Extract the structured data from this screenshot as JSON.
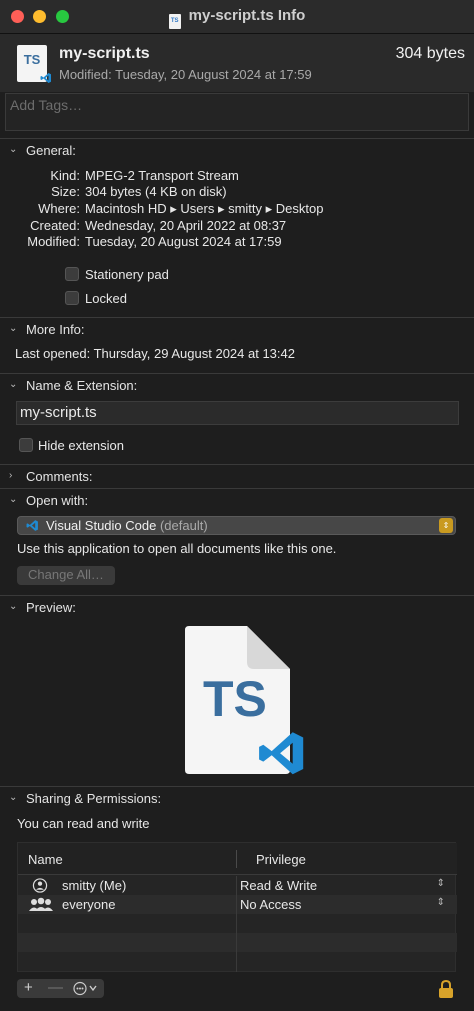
{
  "window": {
    "title": "my-script.ts Info"
  },
  "header": {
    "file_name": "my-script.ts",
    "modified_line": "Modified: Tuesday, 20 August 2024 at 17:59",
    "size": "304 bytes",
    "icon_text": "TS"
  },
  "tags": {
    "placeholder": "Add Tags…"
  },
  "general": {
    "title": "General:",
    "rows": [
      {
        "key": "Kind:",
        "value": "MPEG-2 Transport Stream"
      },
      {
        "key": "Size:",
        "value": "304 bytes (4 KB on disk)"
      },
      {
        "key": "Where:",
        "value": "Macintosh HD ▸ Users ▸ smitty ▸ Desktop"
      },
      {
        "key": "Created:",
        "value": "Wednesday, 20 April 2022 at 08:37"
      },
      {
        "key": "Modified:",
        "value": "Tuesday, 20 August 2024 at 17:59"
      }
    ],
    "stationery_label": "Stationery pad",
    "stationery_checked": false,
    "locked_label": "Locked",
    "locked_checked": false
  },
  "more_info": {
    "title": "More Info:",
    "last_opened_key": "Last opened:",
    "last_opened_value": "Thursday, 29 August 2024 at 13:42"
  },
  "name_ext": {
    "title": "Name & Extension:",
    "name_value": "my-script.ts",
    "hide_ext_label": "Hide extension",
    "hide_ext_checked": false
  },
  "comments": {
    "title": "Comments:"
  },
  "open_with": {
    "title": "Open with:",
    "app_name": "Visual Studio Code",
    "app_suffix": "(default)",
    "description": "Use this application to open all documents like this one.",
    "change_all_label": "Change All…"
  },
  "preview": {
    "title": "Preview:",
    "icon_text": "TS"
  },
  "sharing": {
    "title": "Sharing & Permissions:",
    "summary": "You can read and write",
    "col_name": "Name",
    "col_privilege": "Privilege",
    "rows": [
      {
        "name": "smitty (Me)",
        "privilege": "Read & Write",
        "icon": "person-icon"
      },
      {
        "name": "everyone",
        "privilege": "No Access",
        "icon": "group-icon"
      }
    ],
    "add_label": "+",
    "remove_label": "—"
  },
  "colors": {
    "accent_blue": "#1f8ad2",
    "ts_blue": "#3a6e9e",
    "stepper_gold": "#c99a20",
    "close": "#fe5f57",
    "minimize": "#febc2e",
    "maximize": "#28c840"
  }
}
